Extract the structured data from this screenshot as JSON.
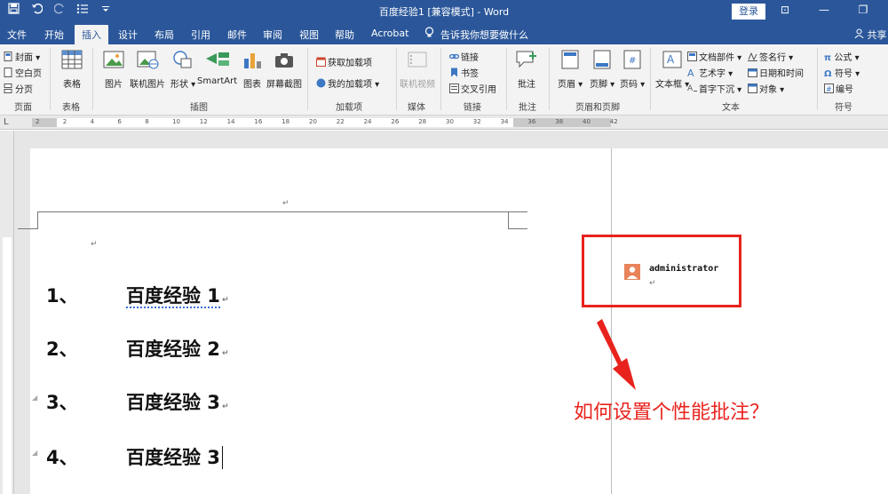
{
  "window": {
    "title": "百度经验1 [兼容模式] - Word",
    "login_label": "登录",
    "accent": "#2b579a",
    "controls": [
      "⊡",
      "—",
      "❐"
    ]
  },
  "quick_access": {
    "save_icon": "save-icon",
    "undo_icon": "undo-icon",
    "redo_icon": "redo-icon",
    "list_icon": "bullets-icon",
    "customize_icon": "customize-icon"
  },
  "tabs": [
    "文件",
    "开始",
    "插入",
    "设计",
    "布局",
    "引用",
    "邮件",
    "审阅",
    "视图",
    "帮助",
    "Acrobat"
  ],
  "active_tab": "插入",
  "tellme": "告诉我你想要做什么",
  "share": "共享",
  "ribbon": {
    "pages": {
      "label": "页面",
      "items": [
        "封面",
        "空白页",
        "分页"
      ]
    },
    "tables": {
      "label": "表格",
      "items": [
        "表格"
      ]
    },
    "illustrations": {
      "label": "插图",
      "items": [
        "图片",
        "联机图片",
        "形状",
        "SmartArt",
        "图表",
        "屏幕截图"
      ]
    },
    "addins": {
      "label": "加载项",
      "items": [
        "获取加载项",
        "我的加载项"
      ]
    },
    "media": {
      "label": "媒体",
      "items": [
        "联机视频"
      ]
    },
    "links": {
      "label": "链接",
      "items": [
        "链接",
        "书签",
        "交叉引用"
      ]
    },
    "comments": {
      "label": "批注",
      "items": [
        "批注"
      ]
    },
    "header_footer": {
      "label": "页眉和页脚",
      "items": [
        "页眉",
        "页脚",
        "页码"
      ]
    },
    "text": {
      "label": "文本",
      "items": [
        "文本框",
        "文档部件",
        "艺术字",
        "首字下沉",
        "签名行",
        "日期和时间",
        "对象"
      ]
    },
    "symbols": {
      "label": "符号",
      "items": [
        "公式",
        "符号",
        "编号"
      ]
    }
  },
  "ruler": {
    "corner": "L",
    "numbers": [
      "2",
      "2",
      "4",
      "6",
      "8",
      "10",
      "12",
      "14",
      "16",
      "18",
      "20",
      "22",
      "24",
      "26",
      "28",
      "30",
      "32",
      "34",
      "36",
      "38",
      "40",
      "42"
    ]
  },
  "document": {
    "paragraph_mark": "↵",
    "list": [
      {
        "num": "1、",
        "text": "百度经验 1"
      },
      {
        "num": "2、",
        "text": "百度经验 2"
      },
      {
        "num": "3、",
        "text": "百度经验 3"
      },
      {
        "num": "4、",
        "text": "百度经验 3"
      }
    ]
  },
  "comment": {
    "author": "administrator",
    "avatar_color": "#e8835a",
    "box_color": "#e8231e"
  },
  "annotation": {
    "text": "如何设置个性能批注？",
    "color": "#e8231e"
  }
}
